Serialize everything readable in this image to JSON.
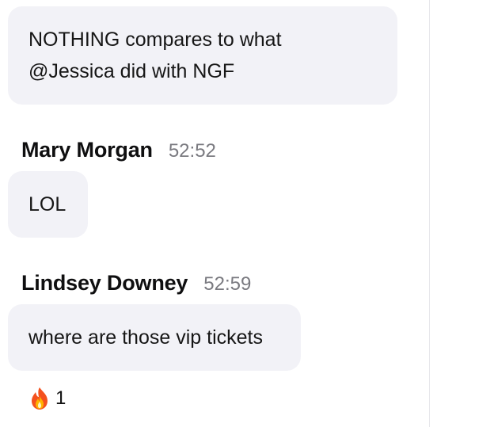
{
  "messages": [
    {
      "text": "NOTHING compares to what\n@Jessica did with NGF"
    },
    {
      "sender": "Mary Morgan",
      "time": "52:52",
      "text": "LOL"
    },
    {
      "sender": "Lindsey Downey",
      "time": "52:59",
      "text": "where are those vip tickets"
    }
  ],
  "reactions": [
    {
      "icon": "fire-icon",
      "count": "1"
    }
  ],
  "colors": {
    "bubble": "#f2f2f7",
    "timestamp": "#7a7a80",
    "divider": "#e6e6ea"
  }
}
